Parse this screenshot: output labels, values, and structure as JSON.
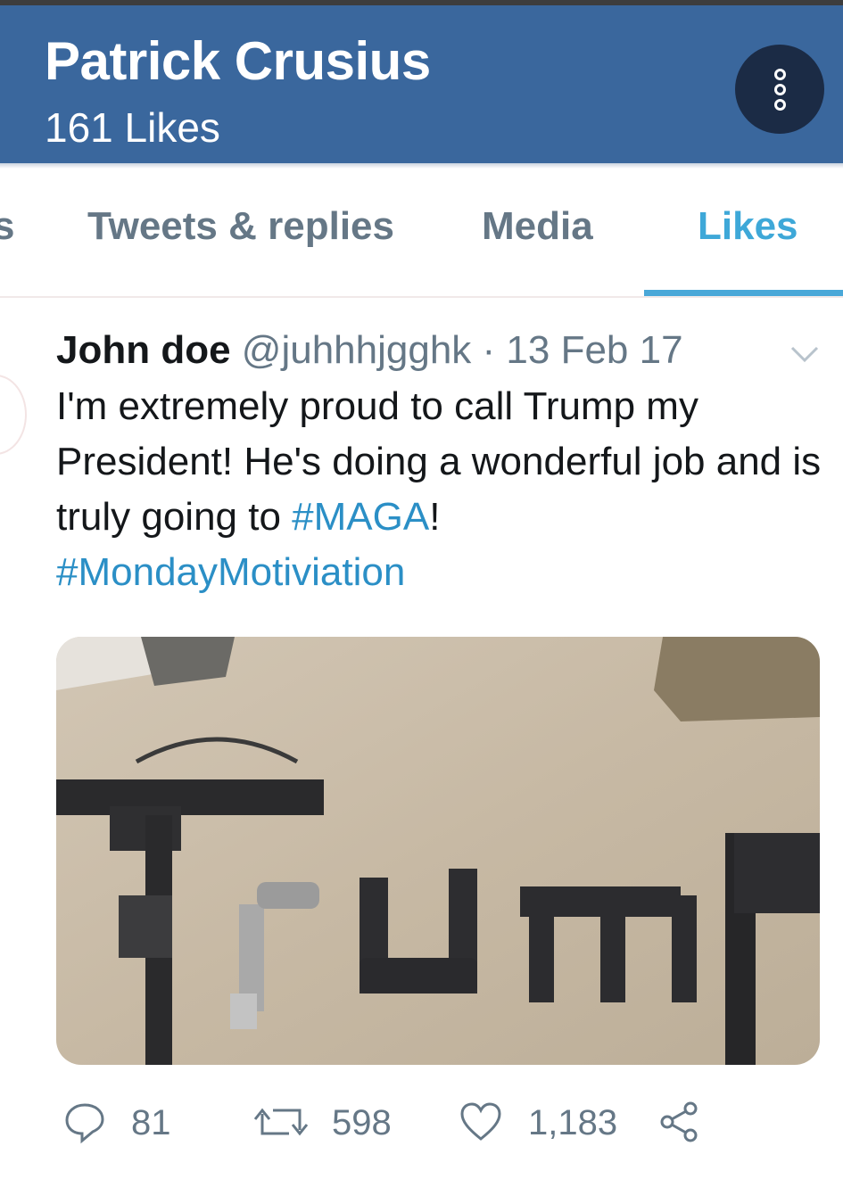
{
  "header": {
    "name": "Patrick Crusius",
    "likes_count": "161 Likes",
    "more_icon": "more-vertical-icon"
  },
  "tabs": [
    {
      "label": "s",
      "active": false
    },
    {
      "label": "Tweets & replies",
      "active": false
    },
    {
      "label": "Media",
      "active": false
    },
    {
      "label": "Likes",
      "active": true
    }
  ],
  "tweet": {
    "author_name": "John doe",
    "handle": "@juhhhjgghk",
    "separator": " · ",
    "date": "13 Feb 17",
    "text_before": "I'm extremely proud to call Trump my President! He's doing a wonderful job and is truly going to ",
    "hashtag1": "#MAGA",
    "text_after": "!",
    "hashtag2": "#MondayMotiviation",
    "replies": "81",
    "retweets": "598",
    "likes": "1,183"
  },
  "colors": {
    "header_bg": "#3a679d",
    "accent": "#3ea8d8",
    "hashtag": "#2b8fc6",
    "muted": "#657786"
  }
}
